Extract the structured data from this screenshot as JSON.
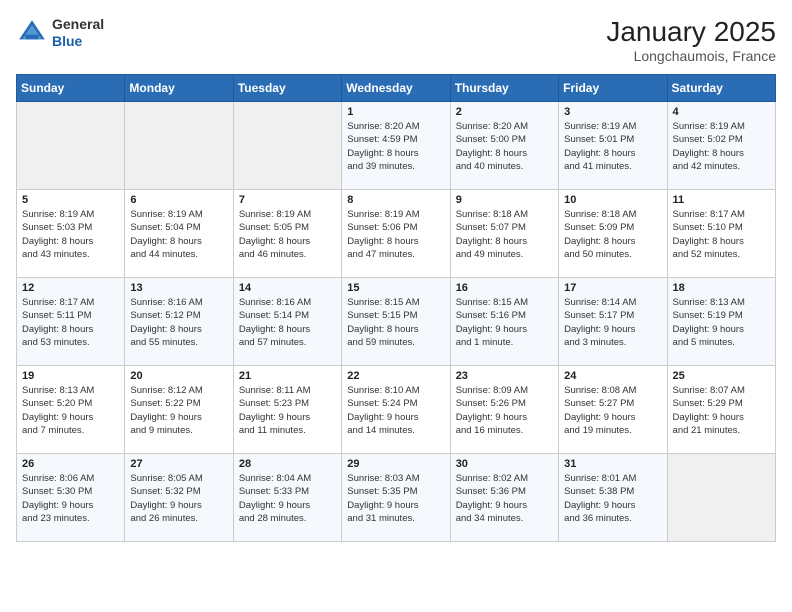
{
  "header": {
    "logo_general": "General",
    "logo_blue": "Blue",
    "month": "January 2025",
    "location": "Longchaumois, France"
  },
  "days_of_week": [
    "Sunday",
    "Monday",
    "Tuesday",
    "Wednesday",
    "Thursday",
    "Friday",
    "Saturday"
  ],
  "weeks": [
    [
      {
        "day": "",
        "info": ""
      },
      {
        "day": "",
        "info": ""
      },
      {
        "day": "",
        "info": ""
      },
      {
        "day": "1",
        "info": "Sunrise: 8:20 AM\nSunset: 4:59 PM\nDaylight: 8 hours\nand 39 minutes."
      },
      {
        "day": "2",
        "info": "Sunrise: 8:20 AM\nSunset: 5:00 PM\nDaylight: 8 hours\nand 40 minutes."
      },
      {
        "day": "3",
        "info": "Sunrise: 8:19 AM\nSunset: 5:01 PM\nDaylight: 8 hours\nand 41 minutes."
      },
      {
        "day": "4",
        "info": "Sunrise: 8:19 AM\nSunset: 5:02 PM\nDaylight: 8 hours\nand 42 minutes."
      }
    ],
    [
      {
        "day": "5",
        "info": "Sunrise: 8:19 AM\nSunset: 5:03 PM\nDaylight: 8 hours\nand 43 minutes."
      },
      {
        "day": "6",
        "info": "Sunrise: 8:19 AM\nSunset: 5:04 PM\nDaylight: 8 hours\nand 44 minutes."
      },
      {
        "day": "7",
        "info": "Sunrise: 8:19 AM\nSunset: 5:05 PM\nDaylight: 8 hours\nand 46 minutes."
      },
      {
        "day": "8",
        "info": "Sunrise: 8:19 AM\nSunset: 5:06 PM\nDaylight: 8 hours\nand 47 minutes."
      },
      {
        "day": "9",
        "info": "Sunrise: 8:18 AM\nSunset: 5:07 PM\nDaylight: 8 hours\nand 49 minutes."
      },
      {
        "day": "10",
        "info": "Sunrise: 8:18 AM\nSunset: 5:09 PM\nDaylight: 8 hours\nand 50 minutes."
      },
      {
        "day": "11",
        "info": "Sunrise: 8:17 AM\nSunset: 5:10 PM\nDaylight: 8 hours\nand 52 minutes."
      }
    ],
    [
      {
        "day": "12",
        "info": "Sunrise: 8:17 AM\nSunset: 5:11 PM\nDaylight: 8 hours\nand 53 minutes."
      },
      {
        "day": "13",
        "info": "Sunrise: 8:16 AM\nSunset: 5:12 PM\nDaylight: 8 hours\nand 55 minutes."
      },
      {
        "day": "14",
        "info": "Sunrise: 8:16 AM\nSunset: 5:14 PM\nDaylight: 8 hours\nand 57 minutes."
      },
      {
        "day": "15",
        "info": "Sunrise: 8:15 AM\nSunset: 5:15 PM\nDaylight: 8 hours\nand 59 minutes."
      },
      {
        "day": "16",
        "info": "Sunrise: 8:15 AM\nSunset: 5:16 PM\nDaylight: 9 hours\nand 1 minute."
      },
      {
        "day": "17",
        "info": "Sunrise: 8:14 AM\nSunset: 5:17 PM\nDaylight: 9 hours\nand 3 minutes."
      },
      {
        "day": "18",
        "info": "Sunrise: 8:13 AM\nSunset: 5:19 PM\nDaylight: 9 hours\nand 5 minutes."
      }
    ],
    [
      {
        "day": "19",
        "info": "Sunrise: 8:13 AM\nSunset: 5:20 PM\nDaylight: 9 hours\nand 7 minutes."
      },
      {
        "day": "20",
        "info": "Sunrise: 8:12 AM\nSunset: 5:22 PM\nDaylight: 9 hours\nand 9 minutes."
      },
      {
        "day": "21",
        "info": "Sunrise: 8:11 AM\nSunset: 5:23 PM\nDaylight: 9 hours\nand 11 minutes."
      },
      {
        "day": "22",
        "info": "Sunrise: 8:10 AM\nSunset: 5:24 PM\nDaylight: 9 hours\nand 14 minutes."
      },
      {
        "day": "23",
        "info": "Sunrise: 8:09 AM\nSunset: 5:26 PM\nDaylight: 9 hours\nand 16 minutes."
      },
      {
        "day": "24",
        "info": "Sunrise: 8:08 AM\nSunset: 5:27 PM\nDaylight: 9 hours\nand 19 minutes."
      },
      {
        "day": "25",
        "info": "Sunrise: 8:07 AM\nSunset: 5:29 PM\nDaylight: 9 hours\nand 21 minutes."
      }
    ],
    [
      {
        "day": "26",
        "info": "Sunrise: 8:06 AM\nSunset: 5:30 PM\nDaylight: 9 hours\nand 23 minutes."
      },
      {
        "day": "27",
        "info": "Sunrise: 8:05 AM\nSunset: 5:32 PM\nDaylight: 9 hours\nand 26 minutes."
      },
      {
        "day": "28",
        "info": "Sunrise: 8:04 AM\nSunset: 5:33 PM\nDaylight: 9 hours\nand 28 minutes."
      },
      {
        "day": "29",
        "info": "Sunrise: 8:03 AM\nSunset: 5:35 PM\nDaylight: 9 hours\nand 31 minutes."
      },
      {
        "day": "30",
        "info": "Sunrise: 8:02 AM\nSunset: 5:36 PM\nDaylight: 9 hours\nand 34 minutes."
      },
      {
        "day": "31",
        "info": "Sunrise: 8:01 AM\nSunset: 5:38 PM\nDaylight: 9 hours\nand 36 minutes."
      },
      {
        "day": "",
        "info": ""
      }
    ]
  ]
}
